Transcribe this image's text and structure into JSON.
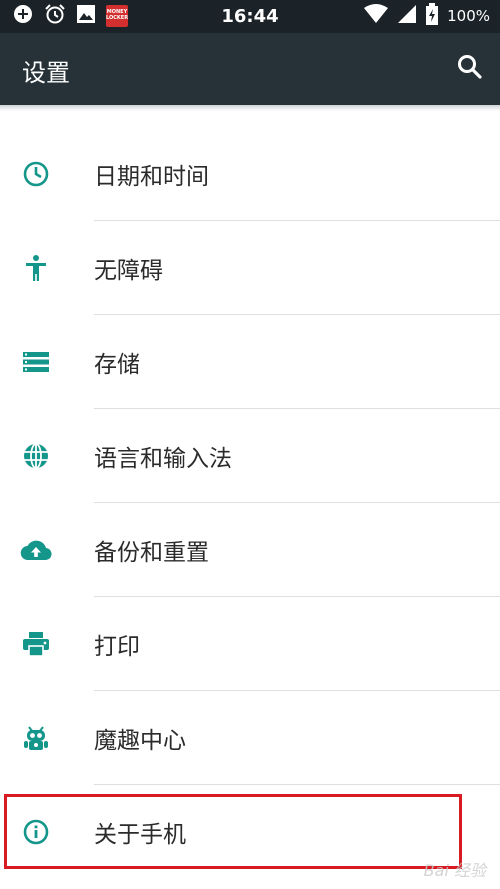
{
  "status_bar": {
    "time": "16:44",
    "battery": "100%",
    "left_icons": [
      "add-circle-icon",
      "alarm-clock-icon",
      "image-icon",
      "money-locker-icon"
    ],
    "right_icons": [
      "wifi-icon",
      "signal-icon",
      "battery-charging-icon"
    ],
    "ad_icon_text": "MONEY LOCKER"
  },
  "app_bar": {
    "title": "设置",
    "search_icon": "search-icon"
  },
  "settings_items": [
    {
      "label": "日期和时间",
      "icon": "clock-icon"
    },
    {
      "label": "无障碍",
      "icon": "accessibility-icon"
    },
    {
      "label": "存储",
      "icon": "storage-icon"
    },
    {
      "label": "语言和输入法",
      "icon": "globe-icon"
    },
    {
      "label": "备份和重置",
      "icon": "cloud-upload-icon"
    },
    {
      "label": "打印",
      "icon": "print-icon"
    },
    {
      "label": "魔趣中心",
      "icon": "android-robot-icon"
    },
    {
      "label": "关于手机",
      "icon": "info-icon"
    }
  ],
  "colors": {
    "status_bar": "#1b2328",
    "app_bar": "#263238",
    "icon_accent": "#15968a",
    "highlight": "#d81b23"
  },
  "watermark": "Bai 经验"
}
